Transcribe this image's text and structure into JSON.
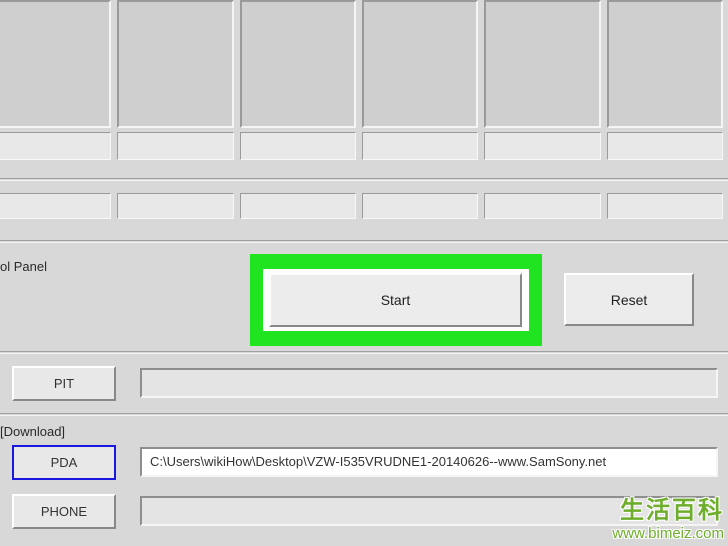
{
  "controlPanel": {
    "label": "ol Panel",
    "startLabel": "Start",
    "resetLabel": "Reset"
  },
  "pit": {
    "buttonLabel": "PIT",
    "value": ""
  },
  "download": {
    "sectionLabel": "[Download]"
  },
  "pda": {
    "buttonLabel": "PDA",
    "value": "C:\\Users\\wikiHow\\Desktop\\VZW-I535VRUDNE1-20140626--www.SamSony.net"
  },
  "phone": {
    "buttonLabel": "PHONE",
    "value": ""
  },
  "watermark": {
    "line1": "生活百科",
    "line2": "www.bimeiz.com"
  }
}
